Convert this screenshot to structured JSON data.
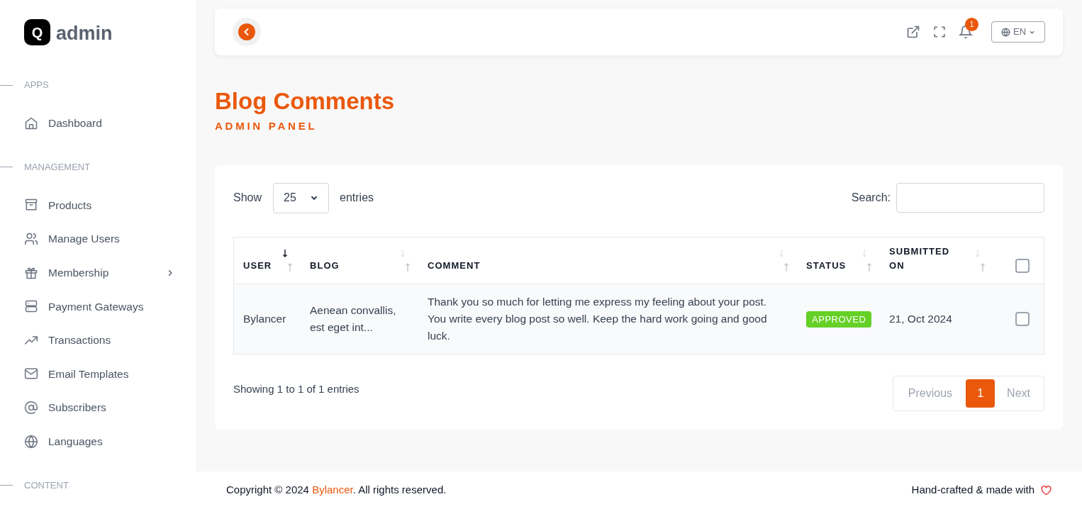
{
  "brand": {
    "logo_letter": "Q",
    "name": "admin"
  },
  "sidebar": {
    "sections": [
      {
        "title": "APPS",
        "items": [
          {
            "label": "Dashboard",
            "has_submenu": false
          }
        ]
      },
      {
        "title": "MANAGEMENT",
        "items": [
          {
            "label": "Products",
            "has_submenu": false
          },
          {
            "label": "Manage Users",
            "has_submenu": false
          },
          {
            "label": "Membership",
            "has_submenu": true
          },
          {
            "label": "Payment Gateways",
            "has_submenu": false
          },
          {
            "label": "Transactions",
            "has_submenu": false
          },
          {
            "label": "Email Templates",
            "has_submenu": false
          },
          {
            "label": "Subscribers",
            "has_submenu": false
          },
          {
            "label": "Languages",
            "has_submenu": false
          }
        ]
      },
      {
        "title": "CONTENT"
      }
    ]
  },
  "topbar": {
    "notification_count": "1",
    "language": "EN"
  },
  "page": {
    "title": "Blog Comments",
    "subtitle": "ADMIN PANEL"
  },
  "table_controls": {
    "show_label": "Show",
    "page_size": "25",
    "entries_label": "entries",
    "search_label": "Search:"
  },
  "table": {
    "columns": [
      {
        "label": "USER",
        "sorted": true
      },
      {
        "label": "BLOG",
        "sorted": false
      },
      {
        "label": "COMMENT",
        "sorted": false
      },
      {
        "label": "STATUS",
        "sorted": false
      },
      {
        "label": "SUBMITTED ON",
        "sorted": false
      }
    ],
    "select_all_checked": false,
    "rows": [
      {
        "user": "Bylancer",
        "blog": "Aenean convallis, est eget int...",
        "comment": "Thank you so much for letting me express my feeling about your post. You write every blog post so well. Keep the hard work going and good luck.",
        "status": "APPROVED",
        "submitted": "21, Oct 2024",
        "checked": false
      }
    ]
  },
  "info": "Showing 1 to 1 of 1 entries",
  "pagination": {
    "previous": "Previous",
    "pages": [
      {
        "label": "1",
        "selected": true
      }
    ],
    "next": "Next"
  },
  "footer": {
    "copyright": "Copyright © 2024 **Bylancer**. All rights reserved.",
    "credit": "Hand-crafted & made with"
  }
}
